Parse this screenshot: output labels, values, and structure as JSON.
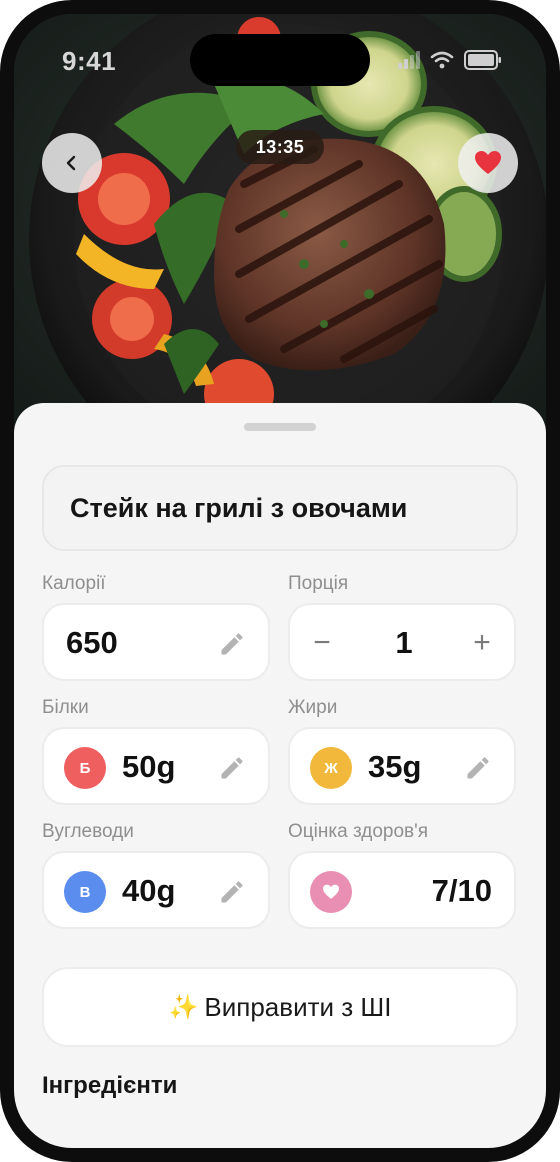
{
  "status_bar": {
    "time": "9:41"
  },
  "hero": {
    "timer": "13:35"
  },
  "icons": {
    "back": "chevron-left-icon",
    "favorite": "heart-icon",
    "edit": "pencil-icon",
    "health": "heart-icon",
    "ai": "sparkles-icon"
  },
  "meal": {
    "title": "Стейк на грилі з овочами"
  },
  "calories": {
    "label": "Калорії",
    "value": "650"
  },
  "portion": {
    "label": "Порція",
    "value": "1",
    "minus": "−",
    "plus": "+"
  },
  "protein": {
    "label": "Білки",
    "badge": "Б",
    "value": "50g",
    "color": "#ef5f5f"
  },
  "fat": {
    "label": "Жири",
    "badge": "Ж",
    "value": "35g",
    "color": "#f2b83c"
  },
  "carbs": {
    "label": "Вуглеводи",
    "badge": "В",
    "value": "40g",
    "color": "#5b8def"
  },
  "health_score": {
    "label": "Оцінка здоров'я",
    "value": "7/10",
    "color": "#e98fb4"
  },
  "ai_fix": {
    "sparkle": "✨",
    "label": "Виправити з ШІ"
  },
  "ingredients": {
    "title": "Інгредієнти"
  },
  "colors": {
    "favorite": "#e8343f",
    "sheet_bg": "#f5f5f5"
  }
}
